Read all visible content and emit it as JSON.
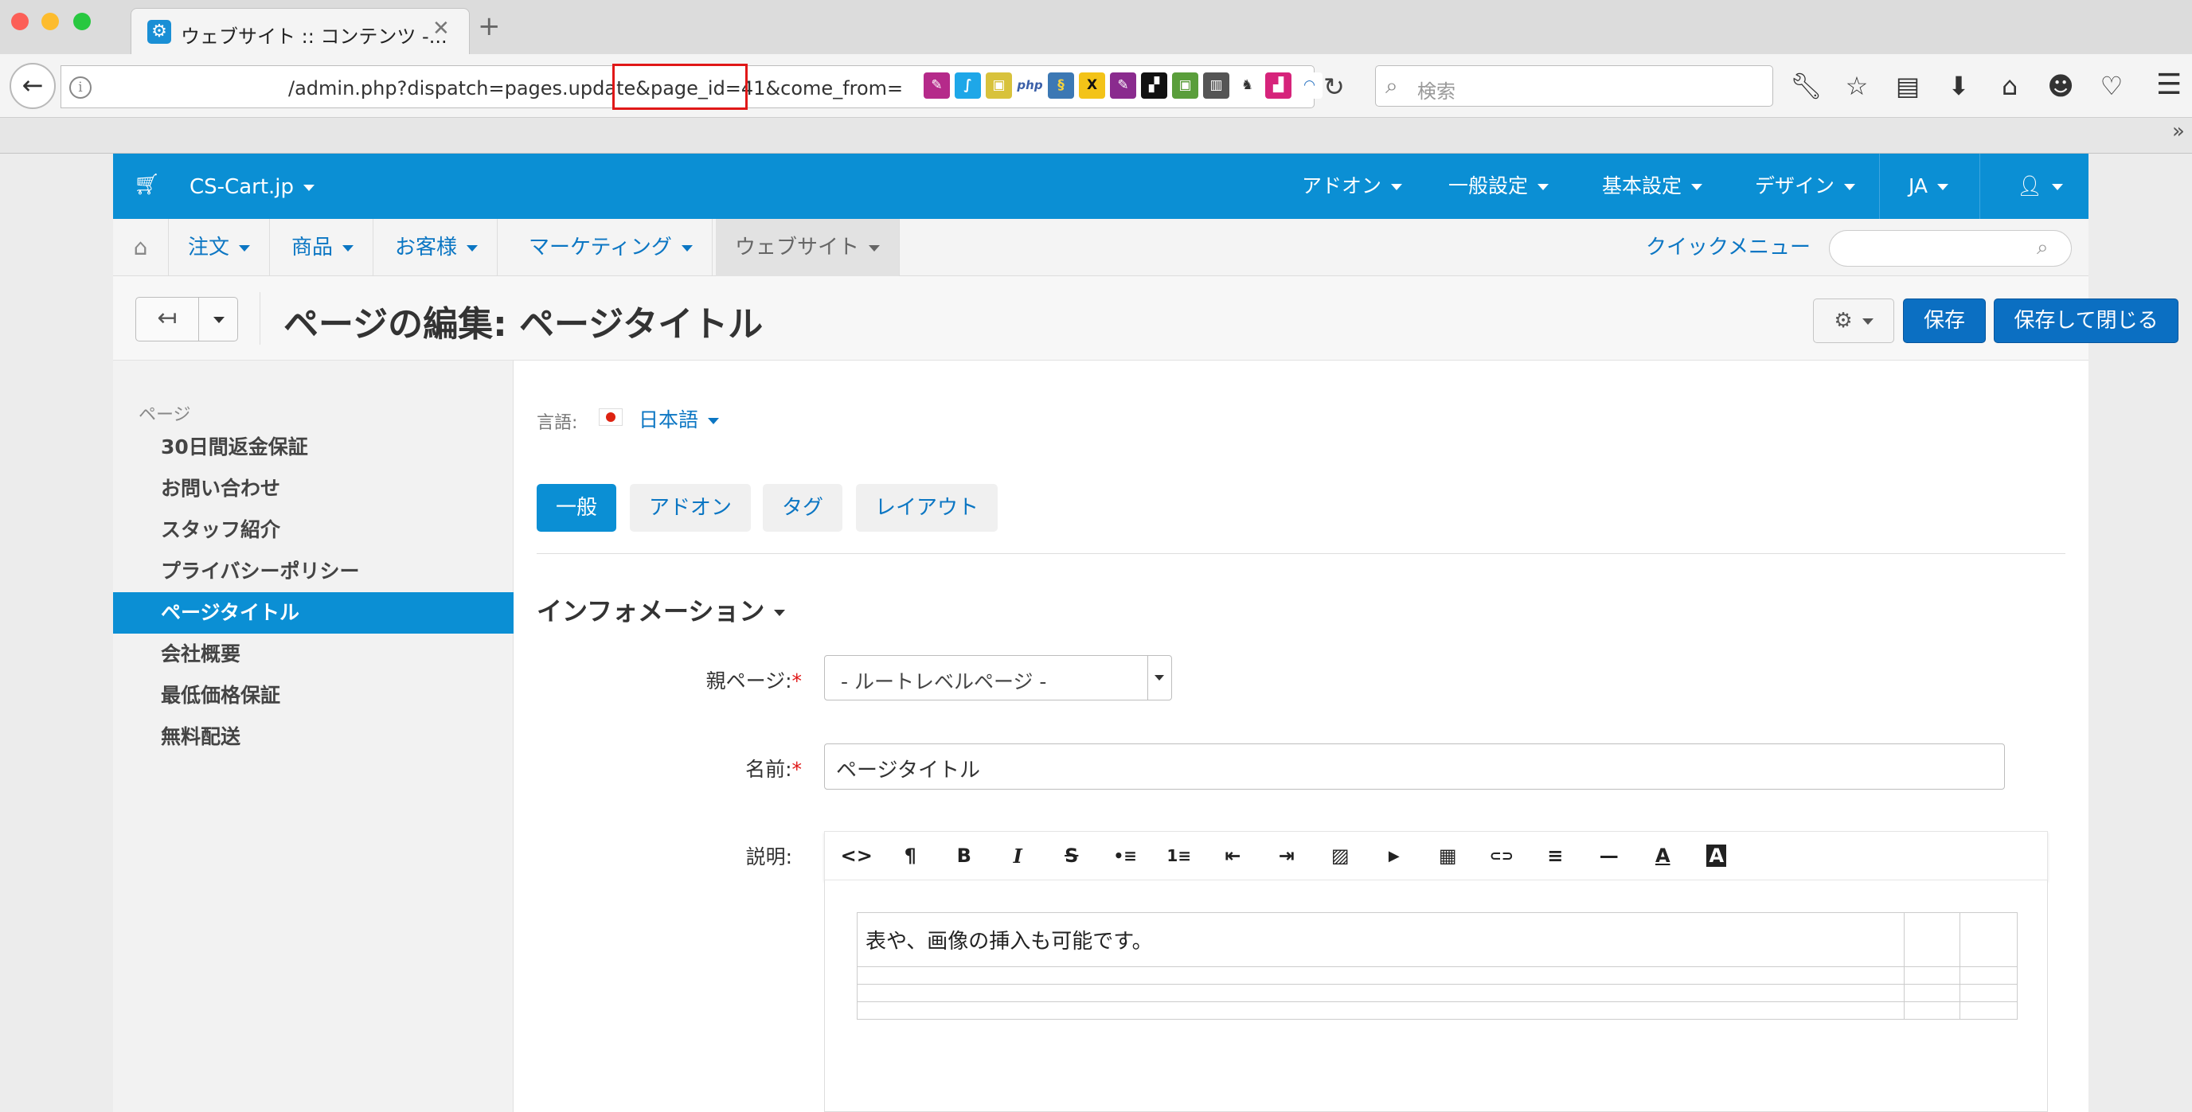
{
  "browser": {
    "tab_title": "ウェブサイト :: コンテンツ -...",
    "tab_close": "✕",
    "new_tab": "+",
    "url": "/admin.php?dispatch=pages.update&page_id=41&come_from=",
    "search_placeholder": "検索",
    "addon_icons": [
      "feather-icon",
      "swift-icon",
      "lock-icon",
      "php-icon",
      "python-icon",
      "x-icon",
      "feather-icon",
      "terminal-icon",
      "lock-icon",
      "library-icon",
      "camel-icon",
      "chart-icon",
      "wave-icon"
    ]
  },
  "app": {
    "store_name": "CS-Cart.jp",
    "top_menu": [
      "アドオン",
      "一般設定",
      "基本設定",
      "デザイン",
      "JA"
    ],
    "main_menu": [
      "注文",
      "商品",
      "お客様",
      "マーケティング",
      "ウェブサイト"
    ],
    "quick_menu": "クイックメニュー",
    "page_title": "ページの編集: ページタイトル",
    "save_label": "保存",
    "save_close_label": "保存して閉じる",
    "colors": {
      "brand": "#0b8fd4",
      "button": "#0b6fc2",
      "required": "#e01818"
    }
  },
  "sidebar": {
    "heading": "ページ",
    "items": [
      {
        "label": "30日間返金保証",
        "active": false
      },
      {
        "label": "お問い合わせ",
        "active": false
      },
      {
        "label": "スタッフ紹介",
        "active": false
      },
      {
        "label": "プライバシーポリシー",
        "active": false
      },
      {
        "label": "ページタイトル",
        "active": true
      },
      {
        "label": "会社概要",
        "active": false
      },
      {
        "label": "最低価格保証",
        "active": false
      },
      {
        "label": "無料配送",
        "active": false
      }
    ]
  },
  "content": {
    "language_label": "言語:",
    "language_value": "日本語",
    "tabs": [
      {
        "label": "一般",
        "active": true
      },
      {
        "label": "アドオン",
        "active": false
      },
      {
        "label": "タグ",
        "active": false
      },
      {
        "label": "レイアウト",
        "active": false
      }
    ],
    "section_title": "インフォメーション",
    "fields": {
      "parent_label": "親ページ:",
      "parent_value": "- ルートレベルページ -",
      "name_label": "名前:",
      "name_value": "ページタイトル",
      "description_label": "説明:",
      "required_mark": "*"
    },
    "editor_tools": [
      "<>",
      "¶",
      "B",
      "I",
      "S",
      "•≡",
      "1≡",
      "⇤",
      "⇥",
      "▨",
      "▶",
      "▦",
      "⊂⊃",
      "≡",
      "—",
      "A",
      "A"
    ],
    "editor_text": "表や、画像の挿入も可能です。"
  }
}
